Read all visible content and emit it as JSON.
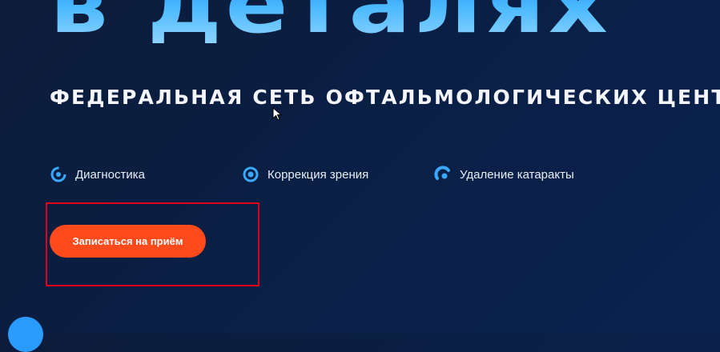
{
  "hero": {
    "title_fragment": "в деталях",
    "subtitle": "ФЕДЕРАЛЬНАЯ СЕТЬ ОФТАЛЬМОЛОГИЧЕСКИХ ЦЕНТРОВ"
  },
  "features": [
    {
      "label": "Диагностика",
      "icon": "diagnostics-icon"
    },
    {
      "label": "Коррекция зрения",
      "icon": "vision-correction-icon"
    },
    {
      "label": "Удаление катаракты",
      "icon": "cataract-removal-icon"
    }
  ],
  "cta": {
    "label": "Записаться на приём"
  },
  "colors": {
    "background": "#0a1f44",
    "accent_orange": "#ff4a1c",
    "icon_blue": "#3aa8ff",
    "highlight_frame": "#e0001b"
  }
}
